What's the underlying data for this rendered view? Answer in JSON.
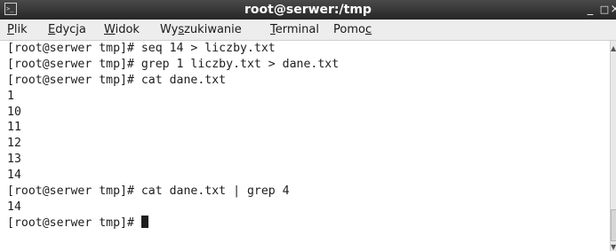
{
  "window": {
    "title": "root@serwer:/tmp",
    "icon": "terminal-icon",
    "controls": {
      "minimize": "_",
      "maximize": "□",
      "close": "×"
    }
  },
  "menu": [
    {
      "pre": "",
      "mnemonic": "P",
      "post": "lik"
    },
    {
      "pre": "",
      "mnemonic": "E",
      "post": "dycja"
    },
    {
      "pre": "",
      "mnemonic": "W",
      "post": "idok"
    },
    {
      "pre": "Wy",
      "mnemonic": "s",
      "post": "zukiwanie"
    },
    {
      "pre": "",
      "mnemonic": "T",
      "post": "erminal"
    },
    {
      "pre": "Pomo",
      "mnemonic": "c",
      "post": ""
    }
  ],
  "terminal": {
    "lines": [
      "[root@serwer tmp]# seq 14 > liczby.txt",
      "[root@serwer tmp]# grep 1 liczby.txt > dane.txt",
      "[root@serwer tmp]# cat dane.txt",
      "1",
      "10",
      "11",
      "12",
      "13",
      "14",
      "[root@serwer tmp]# cat dane.txt | grep 4",
      "14"
    ],
    "prompt": "[root@serwer tmp]# "
  },
  "colors": {
    "titlebar": "#262626",
    "menubar": "#ededed",
    "terminal_bg": "#ffffff",
    "terminal_fg": "#1e1e1e"
  }
}
